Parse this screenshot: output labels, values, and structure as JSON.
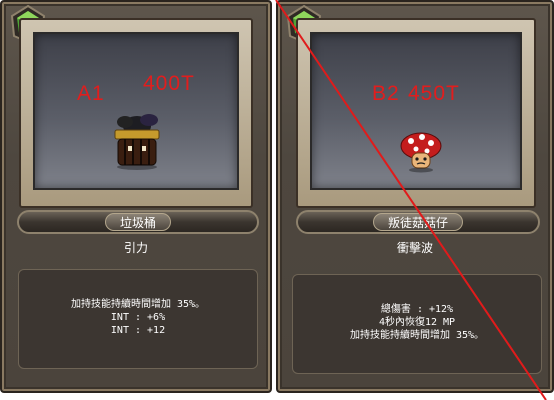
{
  "cards": [
    {
      "tag": "A1",
      "price": "400T",
      "name": "垃圾桶",
      "skill": "引力",
      "effects": [
        "加持技能持續時間增加 35%。",
        "INT : +6%",
        "INT : +12"
      ]
    },
    {
      "tag": "B2",
      "price": "450T",
      "name": "叛徒菇菇仔",
      "skill": "衝擊波",
      "effects": [
        "總傷害 : +12%",
        "4秒內恢復12 MP",
        "加持技能持續時間增加 35%。"
      ]
    }
  ],
  "icons": {
    "gem": "green-gem-icon",
    "creature_a": "trash-can-monster-icon",
    "creature_b": "red-mushroom-icon"
  },
  "colors": {
    "tag_text": "#e21d1d",
    "strike_line": "#e01b1b",
    "gem": "#4fa536"
  }
}
